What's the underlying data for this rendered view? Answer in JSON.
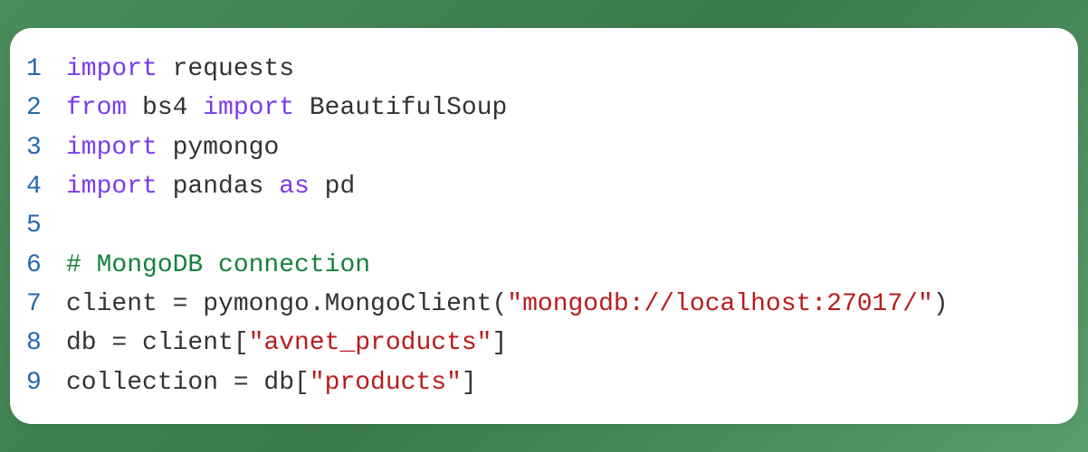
{
  "code": {
    "language": "python",
    "lines": [
      {
        "n": "1",
        "tokens": [
          {
            "c": "kw",
            "t": "import"
          },
          {
            "c": "txt",
            "t": " requests"
          }
        ]
      },
      {
        "n": "2",
        "tokens": [
          {
            "c": "kw",
            "t": "from"
          },
          {
            "c": "txt",
            "t": " bs4 "
          },
          {
            "c": "kw",
            "t": "import"
          },
          {
            "c": "txt",
            "t": " BeautifulSoup"
          }
        ]
      },
      {
        "n": "3",
        "tokens": [
          {
            "c": "kw",
            "t": "import"
          },
          {
            "c": "txt",
            "t": " pymongo"
          }
        ]
      },
      {
        "n": "4",
        "tokens": [
          {
            "c": "kw",
            "t": "import"
          },
          {
            "c": "txt",
            "t": " pandas "
          },
          {
            "c": "kw",
            "t": "as"
          },
          {
            "c": "txt",
            "t": " pd"
          }
        ]
      },
      {
        "n": "5",
        "tokens": [
          {
            "c": "txt",
            "t": ""
          }
        ]
      },
      {
        "n": "6",
        "tokens": [
          {
            "c": "cmt",
            "t": "# MongoDB connection"
          }
        ]
      },
      {
        "n": "7",
        "tokens": [
          {
            "c": "txt",
            "t": "client = pymongo.MongoClient("
          },
          {
            "c": "str",
            "t": "\"mongodb://localhost:27017/\""
          },
          {
            "c": "txt",
            "t": ")"
          }
        ]
      },
      {
        "n": "8",
        "tokens": [
          {
            "c": "txt",
            "t": "db = client["
          },
          {
            "c": "str",
            "t": "\"avnet_products\""
          },
          {
            "c": "txt",
            "t": "]"
          }
        ]
      },
      {
        "n": "9",
        "tokens": [
          {
            "c": "txt",
            "t": "collection = db["
          },
          {
            "c": "str",
            "t": "\"products\""
          },
          {
            "c": "txt",
            "t": "]"
          }
        ]
      }
    ]
  }
}
